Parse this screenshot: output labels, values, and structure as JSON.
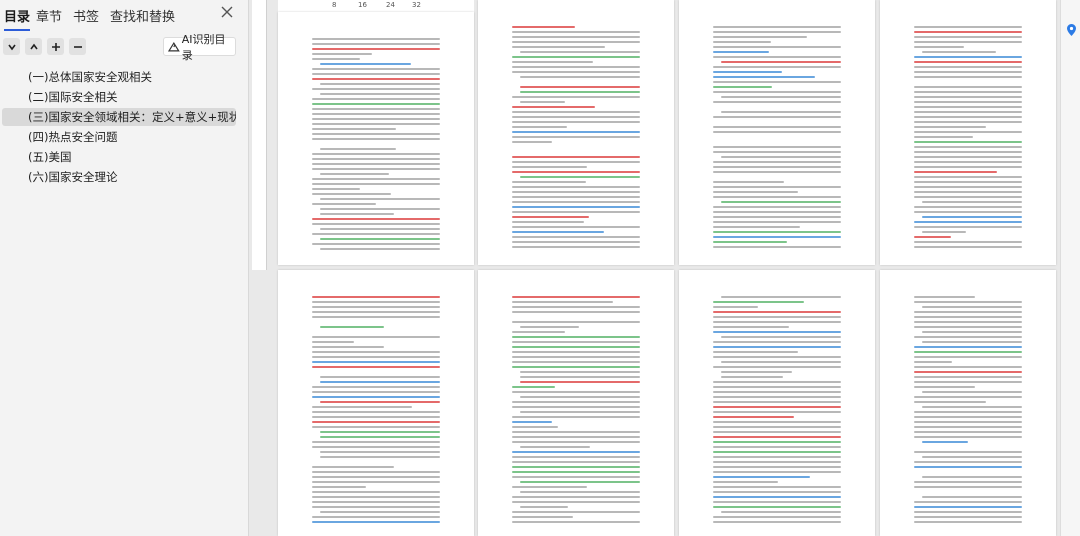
{
  "nav": {
    "tabs": [
      {
        "label": "目录",
        "active": true
      },
      {
        "label": "章节",
        "active": false
      },
      {
        "label": "书签",
        "active": false
      },
      {
        "label": "查找和替换",
        "active": false
      }
    ],
    "ai_button_label": "AI识别目录",
    "outline": [
      {
        "label": "(一)总体国家安全观相关",
        "selected": false
      },
      {
        "label": "(二)国际安全相关",
        "selected": false
      },
      {
        "label": "(三)国家安全领域相关：定义+意义+现状挑战",
        "selected": true
      },
      {
        "label": "(四)热点安全问题",
        "selected": false
      },
      {
        "label": "(五)美国",
        "selected": false
      },
      {
        "label": "(六)国家安全理论",
        "selected": false
      }
    ]
  },
  "ruler": {
    "marks": [
      "8",
      "16",
      "24",
      "32"
    ]
  },
  "colors": {
    "accent": "#2c5cd8",
    "text_line": "#b8b8b8",
    "red_text": "#e46a6a",
    "blue_text": "#6aa6e0",
    "green_text": "#7cc48a"
  }
}
